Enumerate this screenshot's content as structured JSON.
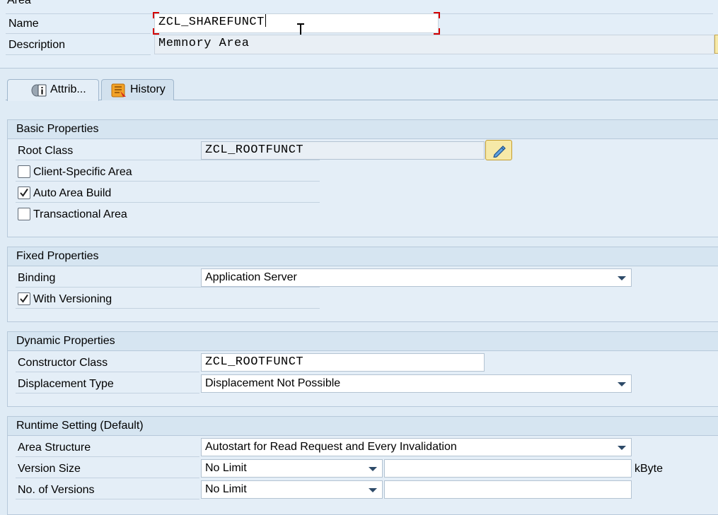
{
  "area": {
    "header": "Area",
    "name_label": "Name",
    "name_value": "ZCL_SHAREFUNCT",
    "description_label": "Description",
    "description_value": "Memnory Area"
  },
  "tabs": [
    {
      "label": "Attrib...",
      "icon": "attributes-icon",
      "active": true
    },
    {
      "label": "History",
      "icon": "history-icon",
      "active": false
    }
  ],
  "basic": {
    "title": "Basic Properties",
    "root_class_label": "Root Class",
    "root_class_value": "ZCL_ROOTFUNCT",
    "client_specific_label": "Client-Specific Area",
    "client_specific_checked": false,
    "auto_build_label": "Auto Area Build",
    "auto_build_checked": true,
    "transactional_label": "Transactional Area",
    "transactional_checked": false
  },
  "fixed": {
    "title": "Fixed Properties",
    "binding_label": "Binding",
    "binding_value": "Application Server",
    "versioning_label": "With Versioning",
    "versioning_checked": true
  },
  "dynamic": {
    "title": "Dynamic Properties",
    "constructor_label": "Constructor Class",
    "constructor_value": "ZCL_ROOTFUNCT",
    "displacement_label": "Displacement Type",
    "displacement_value": "Displacement Not Possible"
  },
  "runtime": {
    "title": "Runtime Setting (Default)",
    "structure_label": "Area Structure",
    "structure_value": "Autostart for Read Request and Every Invalidation",
    "version_size_label": "Version Size",
    "version_size_value": "No Limit",
    "version_size_amount": "",
    "version_size_unit": "kByte",
    "versions_label": "No. of Versions",
    "versions_value": "No Limit",
    "versions_amount": ""
  },
  "colors": {
    "background": "#dfebf5",
    "focus_marker": "#d40000",
    "edit_button": "#f6e9a8"
  }
}
